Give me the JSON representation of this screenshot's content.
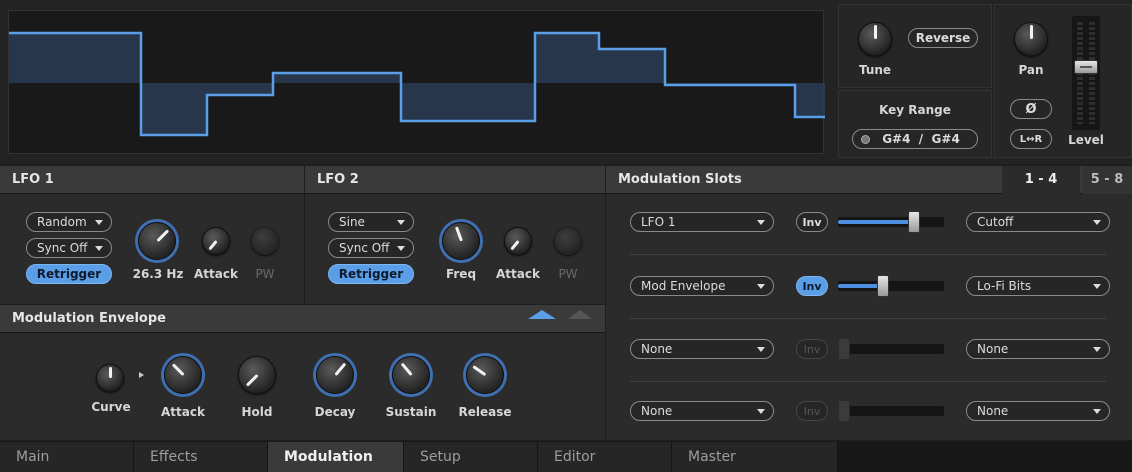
{
  "top": {
    "tune": {
      "label": "Tune"
    },
    "reverse": {
      "label": "Reverse"
    },
    "key_range": {
      "label": "Key Range",
      "value": "G#4  /  G#4"
    },
    "pan": {
      "label": "Pan"
    },
    "phase": {
      "label": "Ø"
    },
    "stereo": {
      "label": "L↔R"
    },
    "level": {
      "label": "Level",
      "value": 0.62
    }
  },
  "lfo1": {
    "title": "LFO 1",
    "waveform": "Random",
    "sync": "Sync Off",
    "retrigger": "Retrigger",
    "rate_label": "26.3 Hz",
    "attack_label": "Attack",
    "pw_label": "PW"
  },
  "lfo2": {
    "title": "LFO 2",
    "waveform": "Sine",
    "sync": "Sync Off",
    "retrigger": "Retrigger",
    "freq_label": "Freq",
    "attack_label": "Attack",
    "pw_label": "PW"
  },
  "mod_env": {
    "title": "Modulation Envelope",
    "knobs": [
      "Curve",
      "Attack",
      "Hold",
      "Decay",
      "Sustain",
      "Release"
    ]
  },
  "mod_slots": {
    "title": "Modulation Slots",
    "tabs": [
      "1 - 4",
      "5 - 8"
    ],
    "active_tab": "1 - 4",
    "inv_label": "Inv",
    "slots": [
      {
        "source": "LFO 1",
        "inv": false,
        "amount": 0.72,
        "target": "Cutoff"
      },
      {
        "source": "Mod Envelope",
        "inv": true,
        "amount": 0.42,
        "target": "Lo-Fi Bits"
      },
      {
        "source": "None",
        "inv": false,
        "amount": 0.0,
        "target": "None"
      },
      {
        "source": "None",
        "inv": false,
        "amount": 0.0,
        "target": "None"
      }
    ]
  },
  "bottom_tabs": [
    "Main",
    "Effects",
    "Modulation",
    "Setup",
    "Editor",
    "Master"
  ],
  "active_tab": "Modulation",
  "colors": {
    "accent": "#5b9ee8",
    "panel": "#2b2b2b",
    "header": "#3a3a3a",
    "waveform": "#5b9ee8"
  }
}
